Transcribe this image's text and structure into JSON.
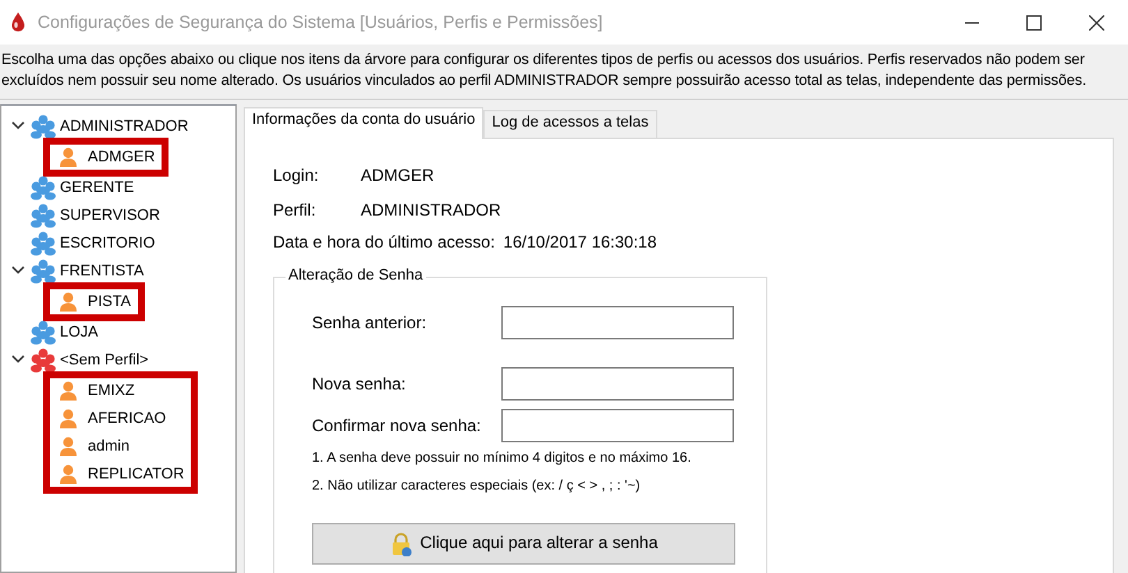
{
  "window": {
    "title": "Configurações de Segurança do Sistema [Usuários, Perfis e Permissões]"
  },
  "description": "Escolha uma das opções abaixo ou clique nos itens da árvore para configurar os diferentes tipos de perfis ou acessos dos usuários. Perfis reservados não podem ser excluídos nem possuir seu nome alterado. Os usuários vinculados ao perfil ADMINISTRADOR sempre possuirão acesso total as telas, independente das permissões.",
  "tree": [
    {
      "label": "ADMINISTRADOR",
      "color": "#4a9be0",
      "expanded": true,
      "highlighted": true,
      "children": [
        {
          "label": "ADMGER"
        }
      ]
    },
    {
      "label": "GERENTE",
      "color": "#4a9be0",
      "expanded": false
    },
    {
      "label": "SUPERVISOR",
      "color": "#4a9be0",
      "expanded": false
    },
    {
      "label": "ESCRITORIO",
      "color": "#4a9be0",
      "expanded": false
    },
    {
      "label": "FRENTISTA",
      "color": "#4a9be0",
      "expanded": true,
      "highlighted": true,
      "children": [
        {
          "label": "PISTA"
        }
      ]
    },
    {
      "label": "LOJA",
      "color": "#4a9be0",
      "expanded": false
    },
    {
      "label": "<Sem Perfil>",
      "color": "#e83a3a",
      "expanded": true,
      "highlighted": true,
      "children": [
        {
          "label": "EMIXZ"
        },
        {
          "label": "AFERICAO"
        },
        {
          "label": "admin"
        },
        {
          "label": "REPLICATOR"
        }
      ]
    }
  ],
  "tabs": [
    {
      "label": "Informações da conta do usuário",
      "selected": true
    },
    {
      "label": "Log de acessos a telas",
      "selected": false
    }
  ],
  "account": {
    "login_label": "Login:",
    "login": "ADMGER",
    "profile_label": "Perfil:",
    "profile": "ADMINISTRADOR",
    "last_access_label": "Data e hora do último acesso:",
    "last_access": "16/10/2017 16:30:18"
  },
  "password_group": {
    "title": "Alteração de Senha",
    "fields": [
      {
        "label": "Senha anterior:"
      },
      {
        "label": "Nova senha:"
      },
      {
        "label": "Confirmar nova senha:"
      }
    ],
    "rules": [
      "1. A senha deve possuir no mínimo 4 digitos e no máximo 16.",
      "2. Não utilizar caracteres especiais (ex: / ç < > , ; : '~)"
    ],
    "button": "Clique aqui para alterar a senha"
  }
}
